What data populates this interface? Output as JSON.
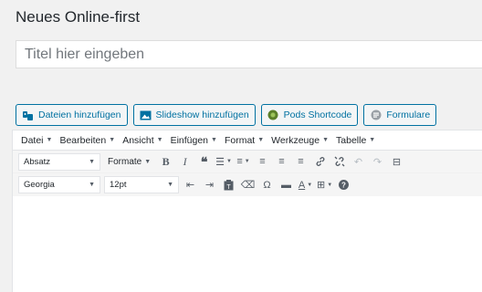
{
  "page_title": "Neues Online-first",
  "title_field": {
    "placeholder": "Titel hier eingeben"
  },
  "media_buttons": [
    {
      "label": "Dateien hinzufügen",
      "icon": "media-icon"
    },
    {
      "label": "Slideshow hinzufügen",
      "icon": "slideshow-icon"
    },
    {
      "label": "Pods Shortcode",
      "icon": "pods-icon"
    },
    {
      "label": "Formulare",
      "icon": "forms-icon"
    }
  ],
  "menubar": [
    "Datei",
    "Bearbeiten",
    "Ansicht",
    "Einfügen",
    "Format",
    "Werkzeuge",
    "Tabelle"
  ],
  "toolbar1": {
    "block_format": "Absatz",
    "formats_label": "Formate"
  },
  "toolbar2": {
    "font_family": "Georgia",
    "font_size": "12pt"
  },
  "colors": {
    "accent": "#0071a1",
    "background": "#f1f1f1"
  }
}
